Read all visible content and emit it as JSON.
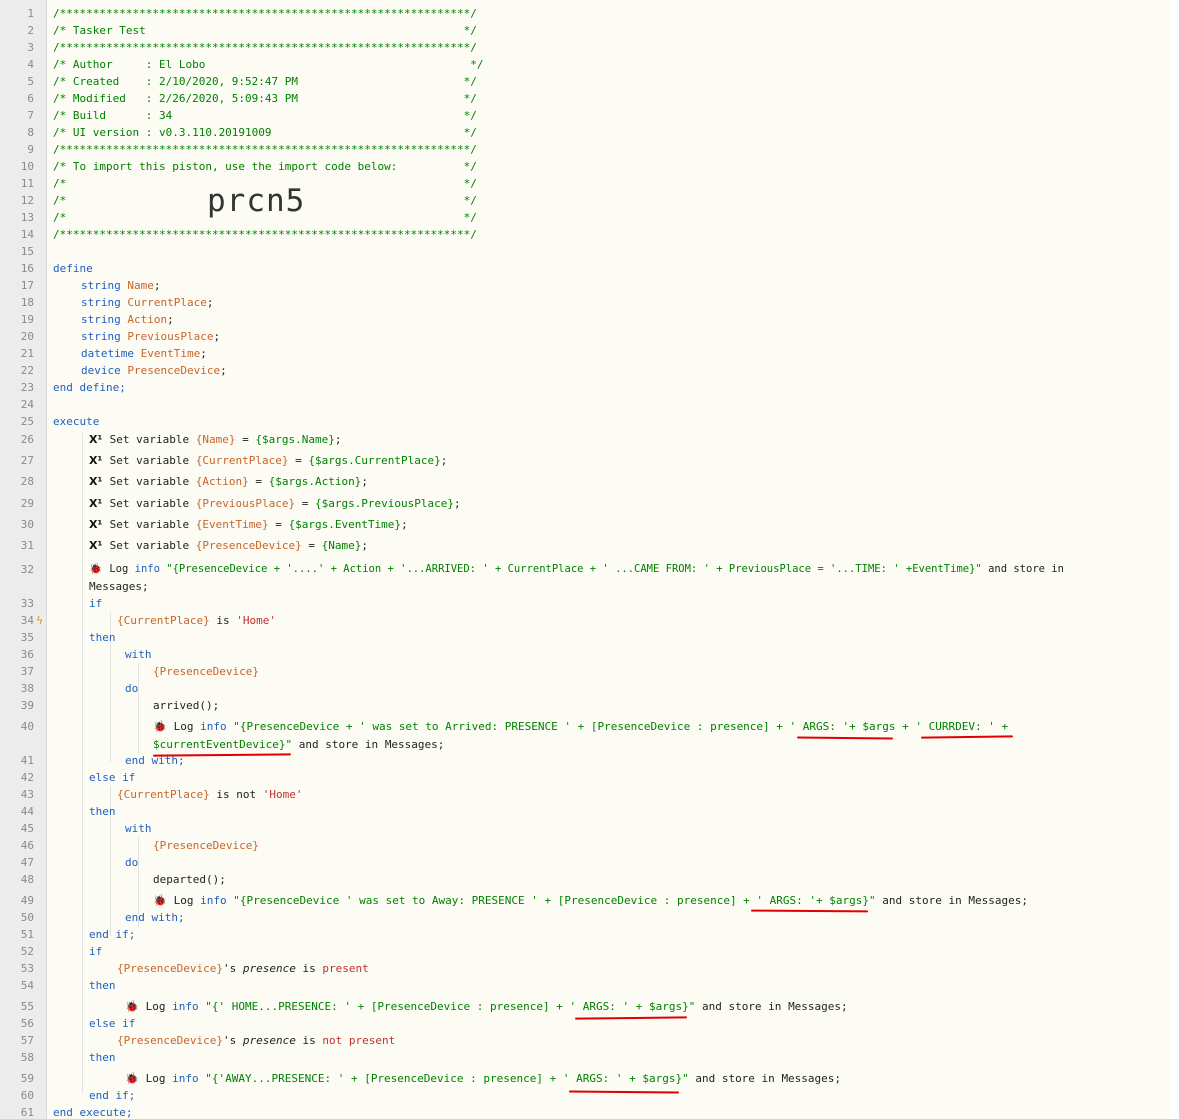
{
  "line_numbers": [
    "1",
    "2",
    "3",
    "4",
    "5",
    "6",
    "7",
    "8",
    "9",
    "10",
    "11",
    "12",
    "13",
    "14",
    "15",
    "16",
    "17",
    "18",
    "19",
    "20",
    "21",
    "22",
    "23",
    "24",
    "25",
    "26",
    "27",
    "28",
    "29",
    "30",
    "31",
    "32",
    "33",
    "34",
    "35",
    "36",
    "37",
    "38",
    "39",
    "40",
    "41",
    "42",
    "43",
    "44",
    "45",
    "46",
    "47",
    "48",
    "49",
    "50",
    "51",
    "52",
    "53",
    "54",
    "55",
    "56",
    "57",
    "58",
    "59",
    "60",
    "61"
  ],
  "header": {
    "rule": "/**************************************************************/",
    "title": "/* Tasker Test                                                */",
    "author": "/* Author     : El Lobo                                        */",
    "created": "/* Created    : 2/10/2020, 9:52:47 PM                         */",
    "modified": "/* Modified   : 2/26/2020, 5:09:43 PM                         */",
    "build": "/* Build      : 34                                            */",
    "ui_version": "/* UI version : v0.3.110.20191009                             */",
    "import_hint": "/* To import this piston, use the import code below:          */",
    "blank": "/*                                                            */",
    "import_code": "prcn5"
  },
  "define": {
    "open": "define",
    "vars": [
      {
        "type": "string",
        "name": "Name"
      },
      {
        "type": "string",
        "name": "CurrentPlace"
      },
      {
        "type": "string",
        "name": "Action"
      },
      {
        "type": "string",
        "name": "PreviousPlace"
      },
      {
        "type": "datetime",
        "name": "EventTime"
      },
      {
        "type": "device",
        "name": "PresenceDevice"
      }
    ],
    "close": "end define;"
  },
  "execute": {
    "open": "execute",
    "close": "end execute;",
    "set_icon": "X¹",
    "set_label": "Set variable",
    "sets": [
      {
        "var": "{Name}",
        "value": "{$args.Name}"
      },
      {
        "var": "{CurrentPlace}",
        "value": "{$args.CurrentPlace}"
      },
      {
        "var": "{Action}",
        "value": "{$args.Action}"
      },
      {
        "var": "{PreviousPlace}",
        "value": "{$args.PreviousPlace}"
      },
      {
        "var": "{EventTime}",
        "value": "{$args.EventTime}"
      },
      {
        "var": "{PresenceDevice}",
        "value": "{Name}"
      }
    ],
    "log_icon": "🐞",
    "log_label": "Log",
    "log_level": "info",
    "store": "and store in",
    "log32_expr": "\"{PresenceDevice + '....' + Action + '...ARRIVED: ' + CurrentPlace + ' ...CAME FROM: ' + PreviousPlace = '...TIME: ' +EventTime}\"",
    "log32_cont": "Messages;",
    "if1": {
      "if": "if",
      "subject": "{CurrentPlace}",
      "is": "is",
      "value": "'Home'",
      "then": "then",
      "with": "with",
      "device": "{PresenceDevice}",
      "do": "do",
      "cmd": "arrived();",
      "log_a": "\"{PresenceDevice + ' was set to Arrived: PRESENCE ' + [PresenceDevice : presence] + ' ARGS: '+ $args + ' CURRDEV: ' +",
      "log_b": "$currentEventDevice}\"",
      "log_b_tail": "Messages;",
      "end_with": "end with;",
      "else_if": "else if",
      "is_not": "is not",
      "cmd2": "departed();",
      "log2": "\"{PresenceDevice ' was set to Away: PRESENCE ' + [PresenceDevice : presence] + ' ARGS: '+ $args}\"",
      "log2_tail": "Messages;",
      "end_if": "end if;"
    },
    "if2": {
      "subject": "{PresenceDevice}",
      "poss": "'s",
      "attr": "presence",
      "is": "is",
      "present": "present",
      "not": "not",
      "log_home": "\"{' HOME...PRESENCE: ' + [PresenceDevice : presence] + ' ARGS: ' + $args}\"",
      "log_away": "\"{'AWAY...PRESENCE: ' + [PresenceDevice : presence] + ' ARGS: ' + $args}\"",
      "tail": "Messages;"
    }
  }
}
